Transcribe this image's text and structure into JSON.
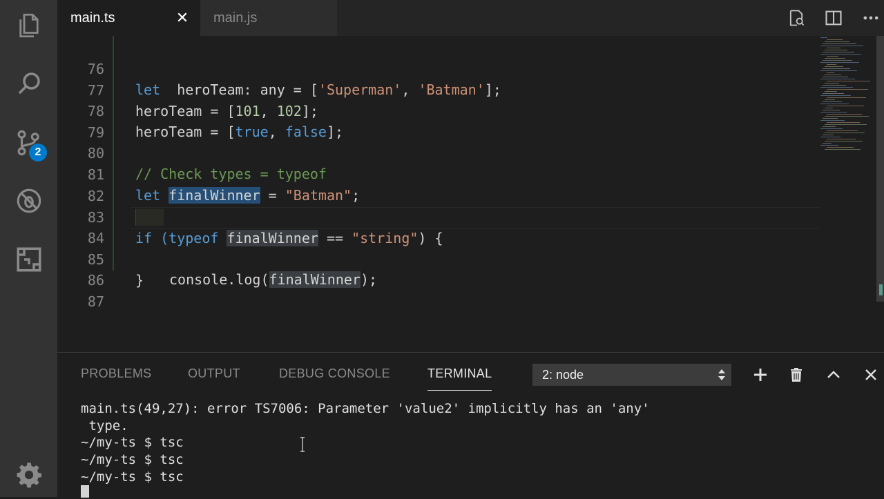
{
  "activity_bar": {
    "scm_badge": "2",
    "icons": [
      "files-icon",
      "search-icon",
      "source-control-icon",
      "debug-icon",
      "extensions-icon",
      "settings-gear-icon"
    ]
  },
  "tabs": [
    {
      "label": "main.ts",
      "active": true
    },
    {
      "label": "main.js",
      "active": false
    }
  ],
  "editor": {
    "line_numbers": [
      "76",
      "77",
      "78",
      "79",
      "80",
      "81",
      "82",
      "83",
      "84",
      "85",
      "86",
      "87"
    ],
    "lines": [
      [
        "let ",
        " heroTeam: any = [",
        "'Superman'",
        ", ",
        "'Batman'",
        "];"
      ],
      [
        "heroTeam = [",
        "101",
        ", ",
        "102",
        "];"
      ],
      [
        "heroTeam = [",
        "true",
        ", ",
        "false",
        "];"
      ],
      [],
      [
        "// Check types = typeof"
      ],
      [
        "let ",
        "finalWinner",
        " = ",
        "\"Batman\"",
        ";"
      ],
      [],
      [
        "if (",
        "typeof",
        " ",
        "finalWinner",
        " == ",
        "\"string\"",
        ") {"
      ],
      [
        "console.log(",
        "finalWinner",
        ");"
      ],
      [
        "}"
      ],
      [],
      []
    ]
  },
  "panel": {
    "tabs": [
      "PROBLEMS",
      "OUTPUT",
      "DEBUG CONSOLE",
      "TERMINAL"
    ],
    "active_tab": "TERMINAL",
    "terminal_select": "2: node",
    "terminal_lines": [
      "main.ts(49,27): error TS7006: Parameter 'value2' implicitly has an 'any'",
      " type.",
      "~/my-ts $ tsc",
      "~/my-ts $ tsc",
      "~/my-ts $ tsc"
    ]
  },
  "colors": {
    "accent": "#007acc",
    "keyword": "#569cd6",
    "string": "#ce9178",
    "number": "#b5cea8",
    "comment": "#6a9955"
  }
}
